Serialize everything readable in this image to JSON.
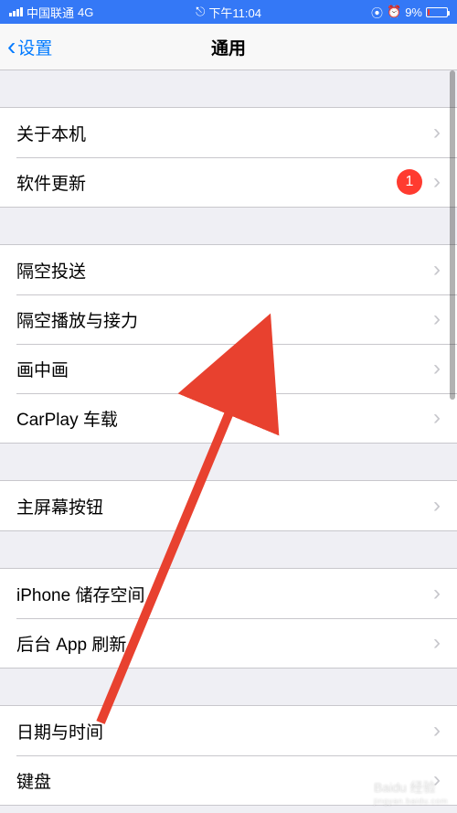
{
  "status_bar": {
    "carrier": "中国联通",
    "network": "4G",
    "time": "下午11:04",
    "battery_percent": "9%",
    "link_icon": "⦾"
  },
  "nav": {
    "back_label": "设置",
    "title": "通用"
  },
  "groups": [
    {
      "rows": [
        {
          "label": "关于本机",
          "badge": null
        },
        {
          "label": "软件更新",
          "badge": "1"
        }
      ]
    },
    {
      "rows": [
        {
          "label": "隔空投送",
          "badge": null
        },
        {
          "label": "隔空播放与接力",
          "badge": null
        },
        {
          "label": "画中画",
          "badge": null
        },
        {
          "label": "CarPlay 车载",
          "badge": null
        }
      ]
    },
    {
      "rows": [
        {
          "label": "主屏幕按钮",
          "badge": null
        }
      ]
    },
    {
      "rows": [
        {
          "label": "iPhone 储存空间",
          "badge": null
        },
        {
          "label": "后台 App 刷新",
          "badge": null
        }
      ]
    },
    {
      "rows": [
        {
          "label": "日期与时间",
          "badge": null
        },
        {
          "label": "键盘",
          "badge": null
        }
      ]
    }
  ],
  "annotation": {
    "arrow_color": "#e8412f"
  },
  "watermark": {
    "main": "Baidu 经验",
    "sub": "jingyan.baidu.com"
  }
}
